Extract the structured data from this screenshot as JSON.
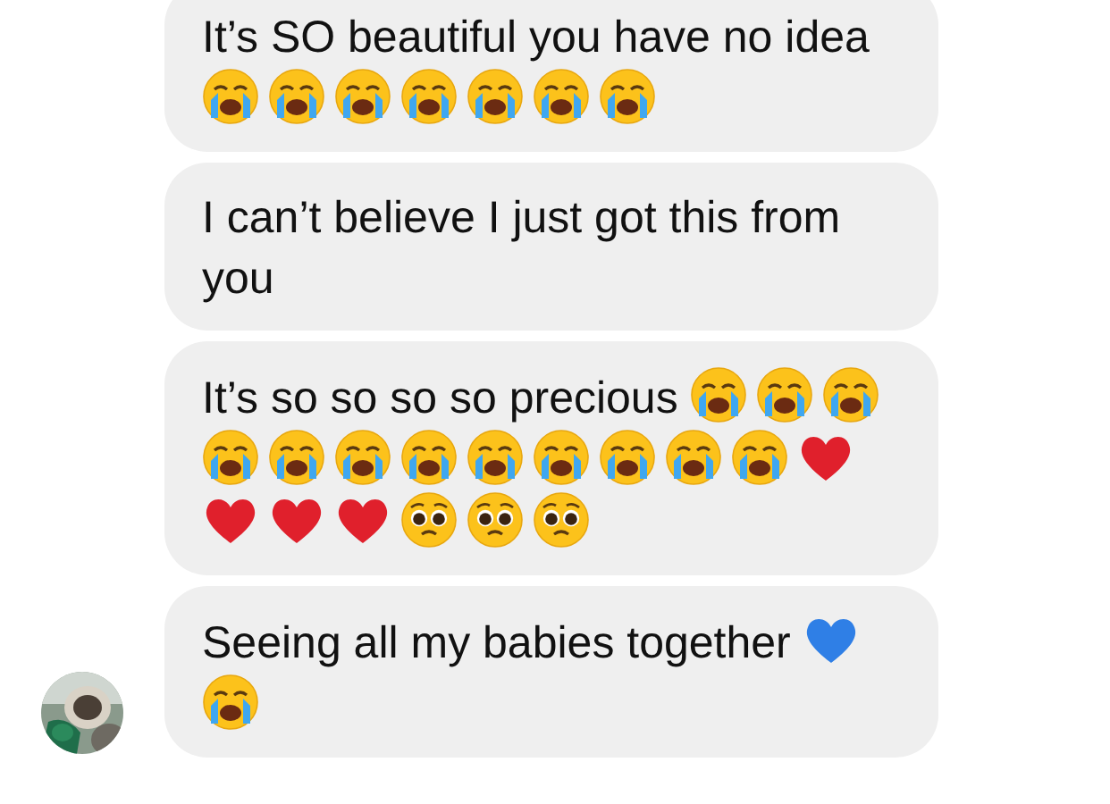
{
  "messages": [
    {
      "text": "It’s SO beautiful you have no idea",
      "emoji": [
        {
          "kind": "crying"
        },
        {
          "kind": "crying"
        },
        {
          "kind": "crying"
        },
        {
          "kind": "crying"
        },
        {
          "kind": "crying"
        },
        {
          "kind": "crying"
        },
        {
          "kind": "crying"
        }
      ]
    },
    {
      "text": "I can’t believe I just got this from you"
    },
    {
      "text": "It’s so so so so precious",
      "emoji": [
        {
          "kind": "crying"
        },
        {
          "kind": "crying"
        },
        {
          "kind": "crying"
        },
        {
          "kind": "crying"
        },
        {
          "kind": "crying"
        },
        {
          "kind": "crying"
        },
        {
          "kind": "crying"
        },
        {
          "kind": "crying"
        },
        {
          "kind": "crying"
        },
        {
          "kind": "crying"
        },
        {
          "kind": "crying"
        },
        {
          "kind": "crying"
        },
        {
          "kind": "heart",
          "color": "#e0202c"
        },
        {
          "kind": "heart",
          "color": "#e0202c"
        },
        {
          "kind": "heart",
          "color": "#e0202c"
        },
        {
          "kind": "heart",
          "color": "#e0202c"
        },
        {
          "kind": "pleading"
        },
        {
          "kind": "pleading"
        },
        {
          "kind": "pleading"
        }
      ]
    },
    {
      "text": "Seeing all my babies together",
      "emoji": [
        {
          "kind": "heart",
          "color": "#2f7fe6"
        },
        {
          "kind": "crying"
        }
      ],
      "avatar": true
    }
  ]
}
